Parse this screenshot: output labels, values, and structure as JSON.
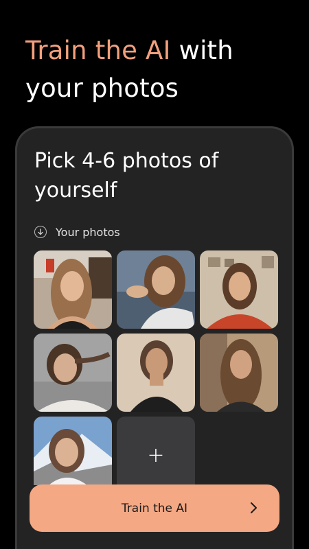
{
  "headline": {
    "accent": "Train the AI",
    "rest": " with your photos",
    "accent_color": "#f4a07d"
  },
  "card": {
    "title": "Pick 4-6 photos of yourself",
    "section_label": "Your photos",
    "section_icon": "download-circle-icon"
  },
  "photos": [
    {
      "desc": "woman by window, black top",
      "palette": [
        "#8b6a50",
        "#c9b9a8",
        "#3a2a20"
      ]
    },
    {
      "desc": "woman lying on bed, white shirt",
      "palette": [
        "#6d7f94",
        "#d9d9d9",
        "#6a4830"
      ]
    },
    {
      "desc": "woman in red top indoors",
      "palette": [
        "#c7b8a3",
        "#c8452a",
        "#5a3c28"
      ]
    },
    {
      "desc": "woman lying on pillow with braid",
      "palette": [
        "#9a9a9a",
        "#e3ddd8",
        "#4a3426"
      ]
    },
    {
      "desc": "woman in black tank top",
      "palette": [
        "#d9c9b5",
        "#1e1e1e",
        "#8a6a4e"
      ]
    },
    {
      "desc": "woman outdoors with long hair",
      "palette": [
        "#a88a6a",
        "#2a2a2a",
        "#6a4a30"
      ]
    },
    {
      "desc": "woman in mountains, white scarf",
      "palette": [
        "#7aa2cf",
        "#f2f2f2",
        "#6a4a38"
      ]
    }
  ],
  "add_tile": {
    "symbol": "+",
    "icon": "plus-icon"
  },
  "cta": {
    "label": "Train the AI",
    "icon": "chevron-right-icon",
    "color": "#f4a884"
  }
}
